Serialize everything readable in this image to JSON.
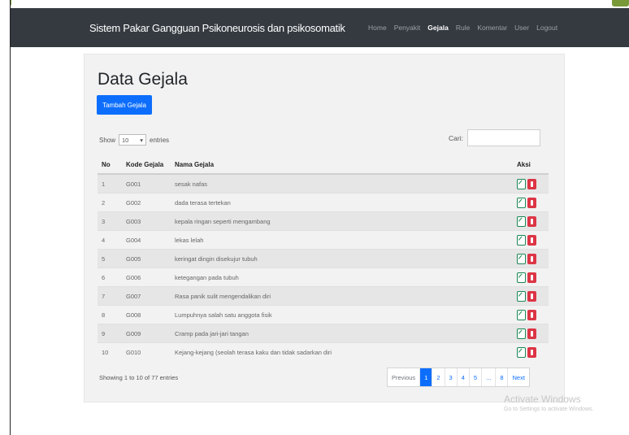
{
  "navbar": {
    "brand": "Sistem Pakar Gangguan Psikoneurosis dan psikosomatik",
    "links": [
      "Home",
      "Penyakit",
      "Gejala",
      "Rule",
      "Komentar",
      "User",
      "Logout"
    ],
    "active_index": 2,
    "background_color": "#343a40"
  },
  "page": {
    "title": "Data Gejala",
    "add_button_label": "Tambah Gejala",
    "show_label": "Show",
    "length_value": "10",
    "entries_label": "entries",
    "search_label": "Cari:",
    "search_value": ""
  },
  "table": {
    "headers": [
      "No",
      "Kode Gejala",
      "Nama Gejala",
      "Aksi"
    ],
    "rows": [
      {
        "no": "1",
        "kode": "G001",
        "nama": "sesak nafas"
      },
      {
        "no": "2",
        "kode": "G002",
        "nama": "dada terasa tertekan"
      },
      {
        "no": "3",
        "kode": "G003",
        "nama": "kepala ringan seperti mengambang"
      },
      {
        "no": "4",
        "kode": "G004",
        "nama": "lekas lelah"
      },
      {
        "no": "5",
        "kode": "G005",
        "nama": "keringat dingin disekujur tubuh"
      },
      {
        "no": "6",
        "kode": "G006",
        "nama": "ketegangan pada tubuh"
      },
      {
        "no": "7",
        "kode": "G007",
        "nama": "Rasa panik sulit mengendalikan diri"
      },
      {
        "no": "8",
        "kode": "G008",
        "nama": "Lumpuhnya salah satu anggota fisik"
      },
      {
        "no": "9",
        "kode": "G009",
        "nama": "Cramp pada jari-jari tangan"
      },
      {
        "no": "10",
        "kode": "G010",
        "nama": "Kejang-kejang (seolah terasa kaku dan tidak sadarkan diri"
      }
    ],
    "edit_icon": "edit-icon",
    "delete_icon": "trash-icon"
  },
  "footer": {
    "info": "Showing 1 to 10 of 77 entries",
    "pagination": [
      "Previous",
      "1",
      "2",
      "3",
      "4",
      "5",
      "...",
      "8",
      "Next"
    ],
    "active_page": "1"
  },
  "watermark": {
    "title": "Activate Windows",
    "subtitle": "Go to Settings to activate Windows."
  },
  "colors": {
    "primary": "#0d6efd",
    "success": "#198754",
    "danger": "#dc3545"
  }
}
